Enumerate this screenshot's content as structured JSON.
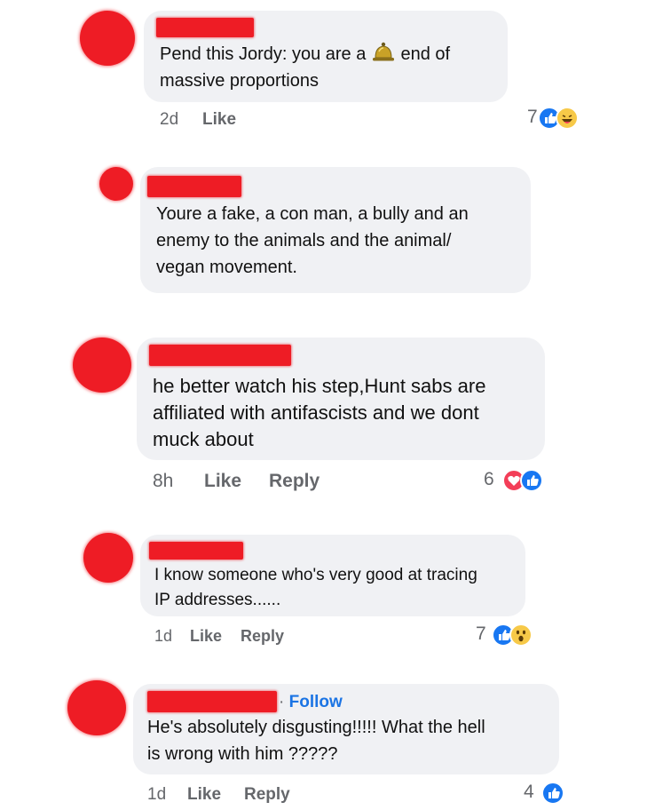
{
  "comments": [
    {
      "text_lines": [
        "Pend this Jordy: you are a",
        "end of",
        "massive proportions"
      ],
      "inline_icon": "bell-icon",
      "time": "2d",
      "like": "Like",
      "reply": "",
      "reaction_count": "7",
      "reaction_icons": [
        "like-icon",
        "haha-icon"
      ]
    },
    {
      "text_lines": [
        "Youre a fake, a con man, a bully and an",
        "enemy to the animals and the animal/",
        "vegan movement."
      ]
    },
    {
      "text_lines": [
        "he better watch his step,Hunt sabs are",
        "affiliated with antifascists and we dont",
        "muck about"
      ],
      "time": "8h",
      "like": "Like",
      "reply": "Reply",
      "reaction_count": "6",
      "reaction_icons": [
        "love-icon",
        "like-icon"
      ]
    },
    {
      "text_lines": [
        "I know someone who's very good at tracing",
        "IP addresses......"
      ],
      "time": "1d",
      "like": "Like",
      "reply": "Reply",
      "reaction_count": "7",
      "reaction_icons": [
        "like-icon",
        "wow-icon"
      ]
    },
    {
      "header_dot": "·",
      "follow": "Follow",
      "text_lines": [
        "He's absolutely disgusting!!!!! What the hell",
        "is wrong with him ?????"
      ],
      "time": "1d",
      "like": "Like",
      "reply": "Reply",
      "reaction_count": "4",
      "reaction_icons": [
        "like-icon"
      ]
    }
  ],
  "colors": {
    "redaction": "#ee1c25",
    "bubble": "#f0f1f4",
    "meta_text": "#65676b",
    "link_blue": "#1b74e4",
    "like_blue": "#1877f2"
  }
}
